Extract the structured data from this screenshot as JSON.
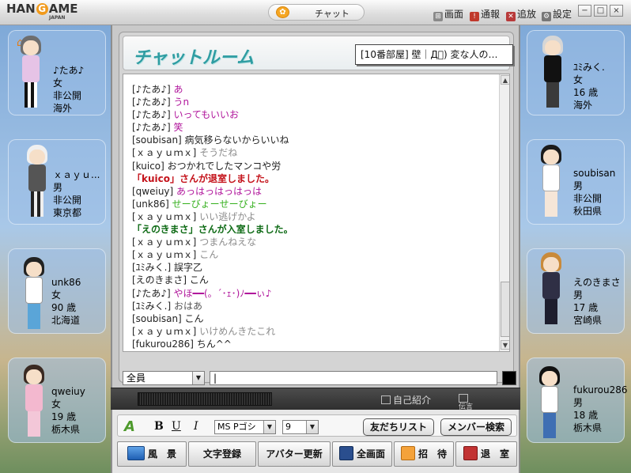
{
  "app": {
    "logo": "HANGAME",
    "logo_sub": "JAPAN",
    "window_title": "チャット",
    "menu": {
      "screen": "画面",
      "report": "通報",
      "expel": "追放",
      "settings": "設定"
    },
    "window_buttons": {
      "minimize": "−",
      "restore": "□",
      "close": "×"
    }
  },
  "room": {
    "title": "チャットルーム",
    "name": "[10番部屋] 壁｜Д゚) 変な人の…"
  },
  "users_left": [
    {
      "name": "♪たあ♪",
      "gender": "女",
      "age": "非公開",
      "region": "海外"
    },
    {
      "name": "ｘａｙｕ...",
      "gender": "男",
      "age": "非公開",
      "region": "東京都"
    },
    {
      "name": "unk86",
      "gender": "女",
      "age": "90 歳",
      "region": "北海道"
    },
    {
      "name": "qweiuy",
      "gender": "女",
      "age": "19 歳",
      "region": "栃木県"
    }
  ],
  "users_right": [
    {
      "name": "ﾕﾐみく.",
      "gender": "女",
      "age": "16 歳",
      "region": "海外"
    },
    {
      "name": "soubisan",
      "gender": "男",
      "age": "非公開",
      "region": "秋田県"
    },
    {
      "name": "えのきまさ",
      "gender": "男",
      "age": "17 歳",
      "region": "宮崎県"
    },
    {
      "name": "fukurou286",
      "gender": "男",
      "age": "18 歳",
      "region": "栃木県"
    }
  ],
  "messages": [
    {
      "text": "[♪たあ♪] ",
      "body": "あ",
      "color": "#b0159b"
    },
    {
      "text": "[♪たあ♪] ",
      "body": "うn",
      "color": "#b0159b"
    },
    {
      "text": "[♪たあ♪] ",
      "body": "いってもいいお",
      "color": "#b0159b"
    },
    {
      "text": "[♪たあ♪] ",
      "body": "笑",
      "color": "#b0159b"
    },
    {
      "text": "[soubisan] ",
      "body": "病気移らないからいいね",
      "color": "#222222"
    },
    {
      "text": "[ｘａｙｕｍｘ] ",
      "body": "そうだね",
      "color": "#8c8c8c"
    },
    {
      "text": "[kuico] ",
      "body": "おつかれでしたマンコや労",
      "color": "#222222"
    },
    {
      "text": "",
      "body": "「kuico」さんが退室しました。",
      "color": "#c4121a",
      "sys": true
    },
    {
      "text": "[qweiuy] ",
      "body": "あっはっはっはっは",
      "color": "#b0159b"
    },
    {
      "text": "[unk86] ",
      "body": "せーびょーせーびょー",
      "color": "#35b01e"
    },
    {
      "text": "[ｘａｙｕｍｘ] ",
      "body": "いい逃げかよ",
      "color": "#8c8c8c"
    },
    {
      "text": "",
      "body": "「えのきまさ」さんが入室しました。",
      "color": "#0f6b16",
      "sys": true
    },
    {
      "text": "[ｘａｙｕｍｘ] ",
      "body": "つまんねえな",
      "color": "#8c8c8c"
    },
    {
      "text": "[ｘａｙｕｍｘ] ",
      "body": "こん",
      "color": "#8c8c8c"
    },
    {
      "text": "[ﾕﾐみく.] ",
      "body": "誤字乙",
      "color": "#222222"
    },
    {
      "text": "[えのきまさ] ",
      "body": "こん",
      "color": "#222222"
    },
    {
      "text": "[♪たあ♪] ",
      "body": "やほ━━(。´･ｪ･)ﾉ━━ぃ♪",
      "color": "#b0159b"
    },
    {
      "text": "[ﾕﾐみく.] ",
      "body": "おはあ",
      "color": "#555555"
    },
    {
      "text": "[soubisan] ",
      "body": "こん",
      "color": "#222222"
    },
    {
      "text": "[ｘａｙｕｍｘ] ",
      "body": "いけめんきたこれ",
      "color": "#8c8c8c"
    },
    {
      "text": "[fukurou286] ",
      "body": "ちん^^",
      "color": "#222222"
    }
  ],
  "input": {
    "target": "全員",
    "value": "|"
  },
  "status": {
    "profile": "自己紹介",
    "denial_line1": "伝言",
    "denial_line2": "禁止"
  },
  "format": {
    "bold": "B",
    "underline": "U",
    "italic": "I",
    "font": "MS Pゴシ",
    "size": "9",
    "friends_button": "友だちリスト",
    "member_search_button": "メンバー検索"
  },
  "actions": {
    "scenery": "風　景",
    "emoticon": "文字登録",
    "avatar": "アバター更新",
    "fullscreen": "全画面",
    "invite": "招　待",
    "leave": "退　室"
  },
  "colors": {
    "accent": "#2e9da2",
    "panel": "#d4d4d4"
  }
}
